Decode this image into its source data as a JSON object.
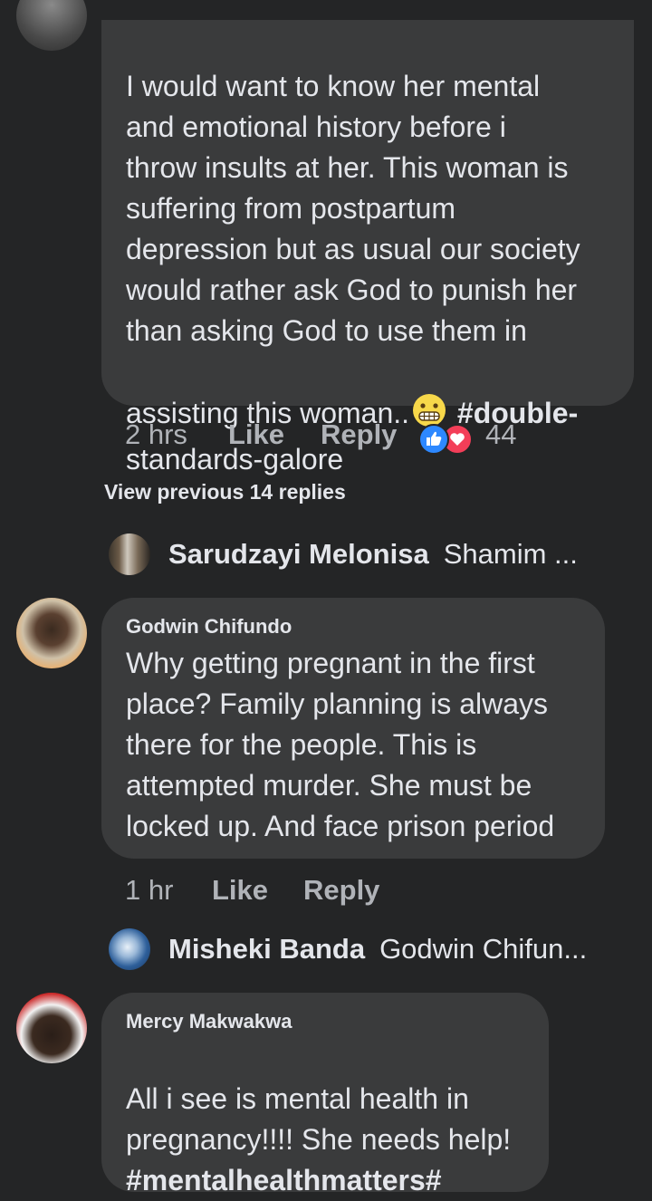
{
  "comment1": {
    "text_before_emoji": "I would want to know her mental\nand emotional history before i\nthrow insults at her.  This woman is\nsuffering from postpartum\ndepression but as usual our society\nwould rather ask God to punish her\nthan asking God to use them in\nassisting this woman..",
    "hashtag": "#double-",
    "text_after": "standards-galore",
    "time": "2 hrs",
    "like_label": "Like",
    "reply_label": "Reply",
    "reaction_count": "44",
    "emoji_icon": "grimacing-face-icon",
    "reaction_icons": [
      "like-reaction-icon",
      "love-reaction-icon"
    ],
    "colors": {
      "like": "#2d88ff",
      "love": "#f33e58",
      "emoji": "#f7d84a"
    }
  },
  "view_previous": "View previous 14 replies",
  "reply1": {
    "name": "Sarudzayi  Melonisa",
    "preview": "Shamim ..."
  },
  "comment2": {
    "author": "Godwin Chifundo",
    "text": "Why getting pregnant in the first\nplace? Family planning is always\nthere for the people. This is\nattempted murder. She must be\nlocked up. And face prison period",
    "time": "1 hr",
    "like_label": "Like",
    "reply_label": "Reply"
  },
  "reply2": {
    "name": "Misheki Banda",
    "preview": "Godwin Chifun..."
  },
  "comment3": {
    "author": "Mercy Makwakwa",
    "text": "All i see is mental health in\npregnancy!!!! She needs help!",
    "hashtag": "#mentalhealthmatters#"
  },
  "theme": {
    "background": "#242526",
    "bubble": "#3a3b3c",
    "text": "#e4e6eb",
    "muted": "#b0b3b8"
  }
}
